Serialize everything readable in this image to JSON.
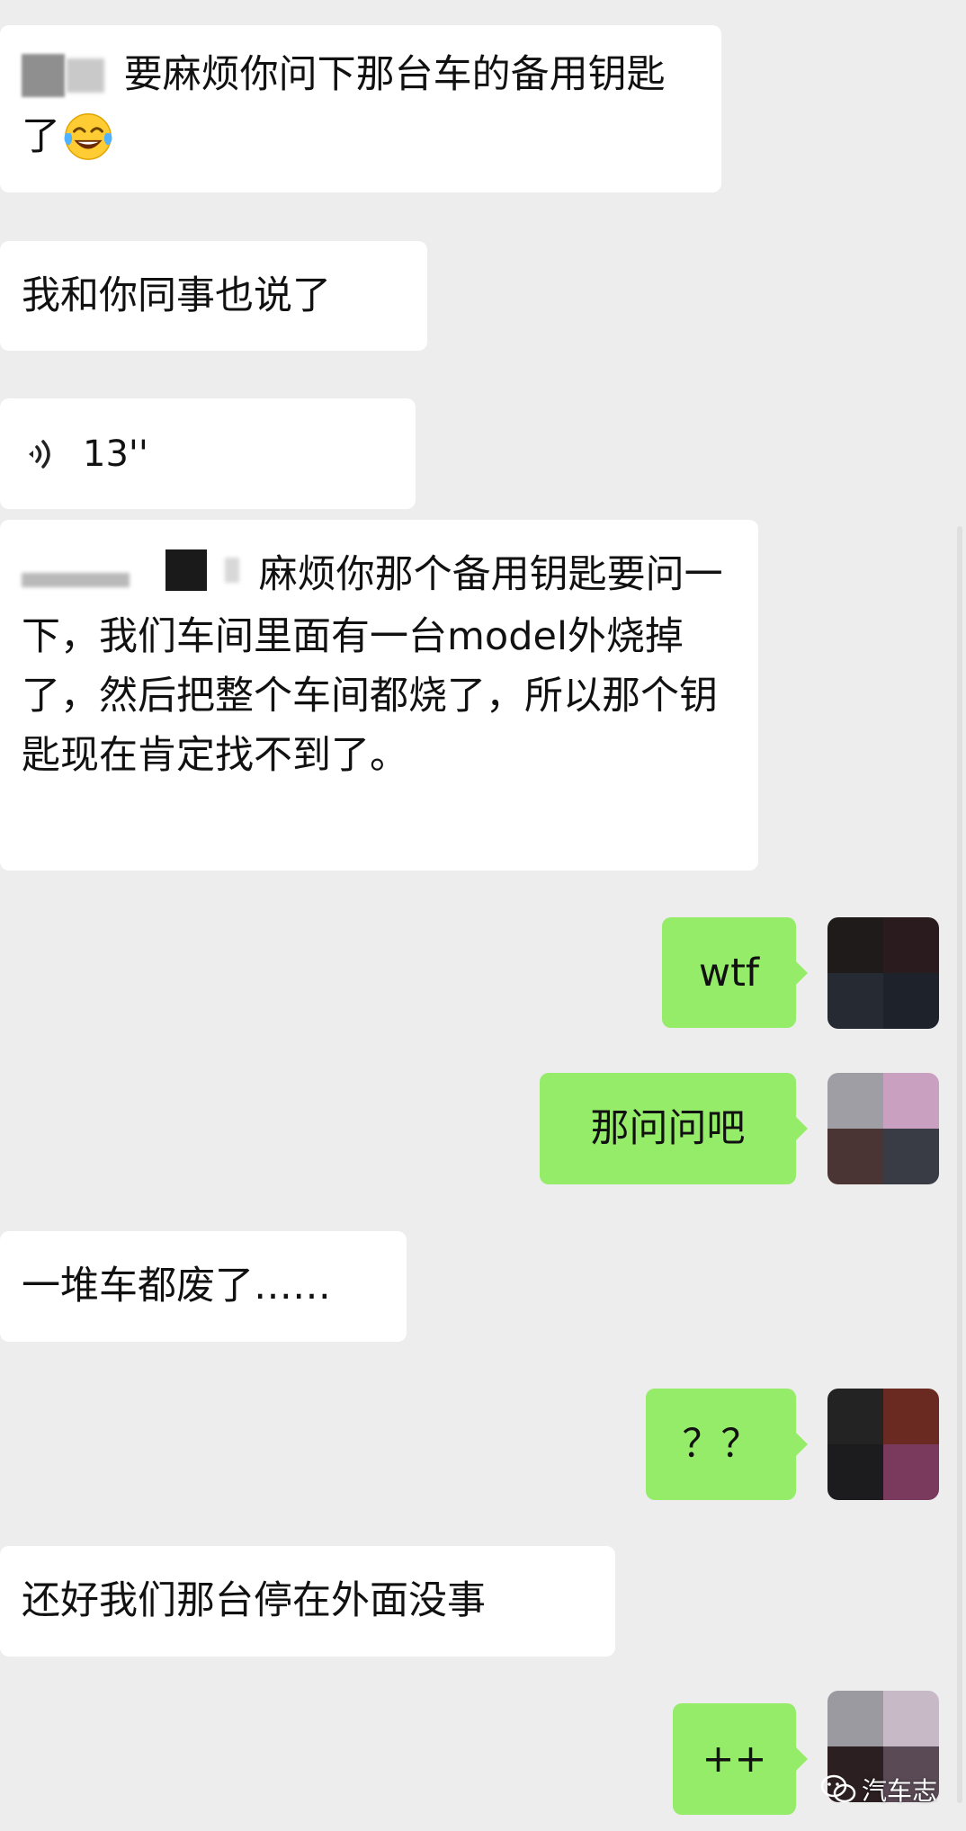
{
  "messages": [
    {
      "side": "in",
      "kind": "text",
      "prefix_hidden": true,
      "text": "要麻烦你问下那台车的备用钥匙了",
      "emoji": "joy"
    },
    {
      "side": "in",
      "kind": "text",
      "text": "我和你同事也说了"
    },
    {
      "side": "in",
      "kind": "voice",
      "duration": "13''"
    },
    {
      "side": "in",
      "kind": "text",
      "prefix_hidden": true,
      "text": "麻烦你那个备用钥匙要问一下，我们车间里面有一台model外烧掉了，然后把整个车间都烧了，所以那个钥匙现在肯定找不到了。"
    },
    {
      "side": "out",
      "kind": "text",
      "text": "wtf"
    },
    {
      "side": "out",
      "kind": "text",
      "text": "那问问吧"
    },
    {
      "side": "in",
      "kind": "text",
      "text": "一堆车都废了……"
    },
    {
      "side": "out",
      "kind": "text",
      "text": "？？"
    },
    {
      "side": "in",
      "kind": "text",
      "text": "还好我们那台停在外面没事"
    },
    {
      "side": "out",
      "kind": "text",
      "text": "++"
    }
  ],
  "watermark": {
    "text": "汽车志"
  },
  "colors": {
    "background": "#ededed",
    "incoming_bubble": "#ffffff",
    "outgoing_bubble": "#95ec69",
    "text": "#111111"
  }
}
